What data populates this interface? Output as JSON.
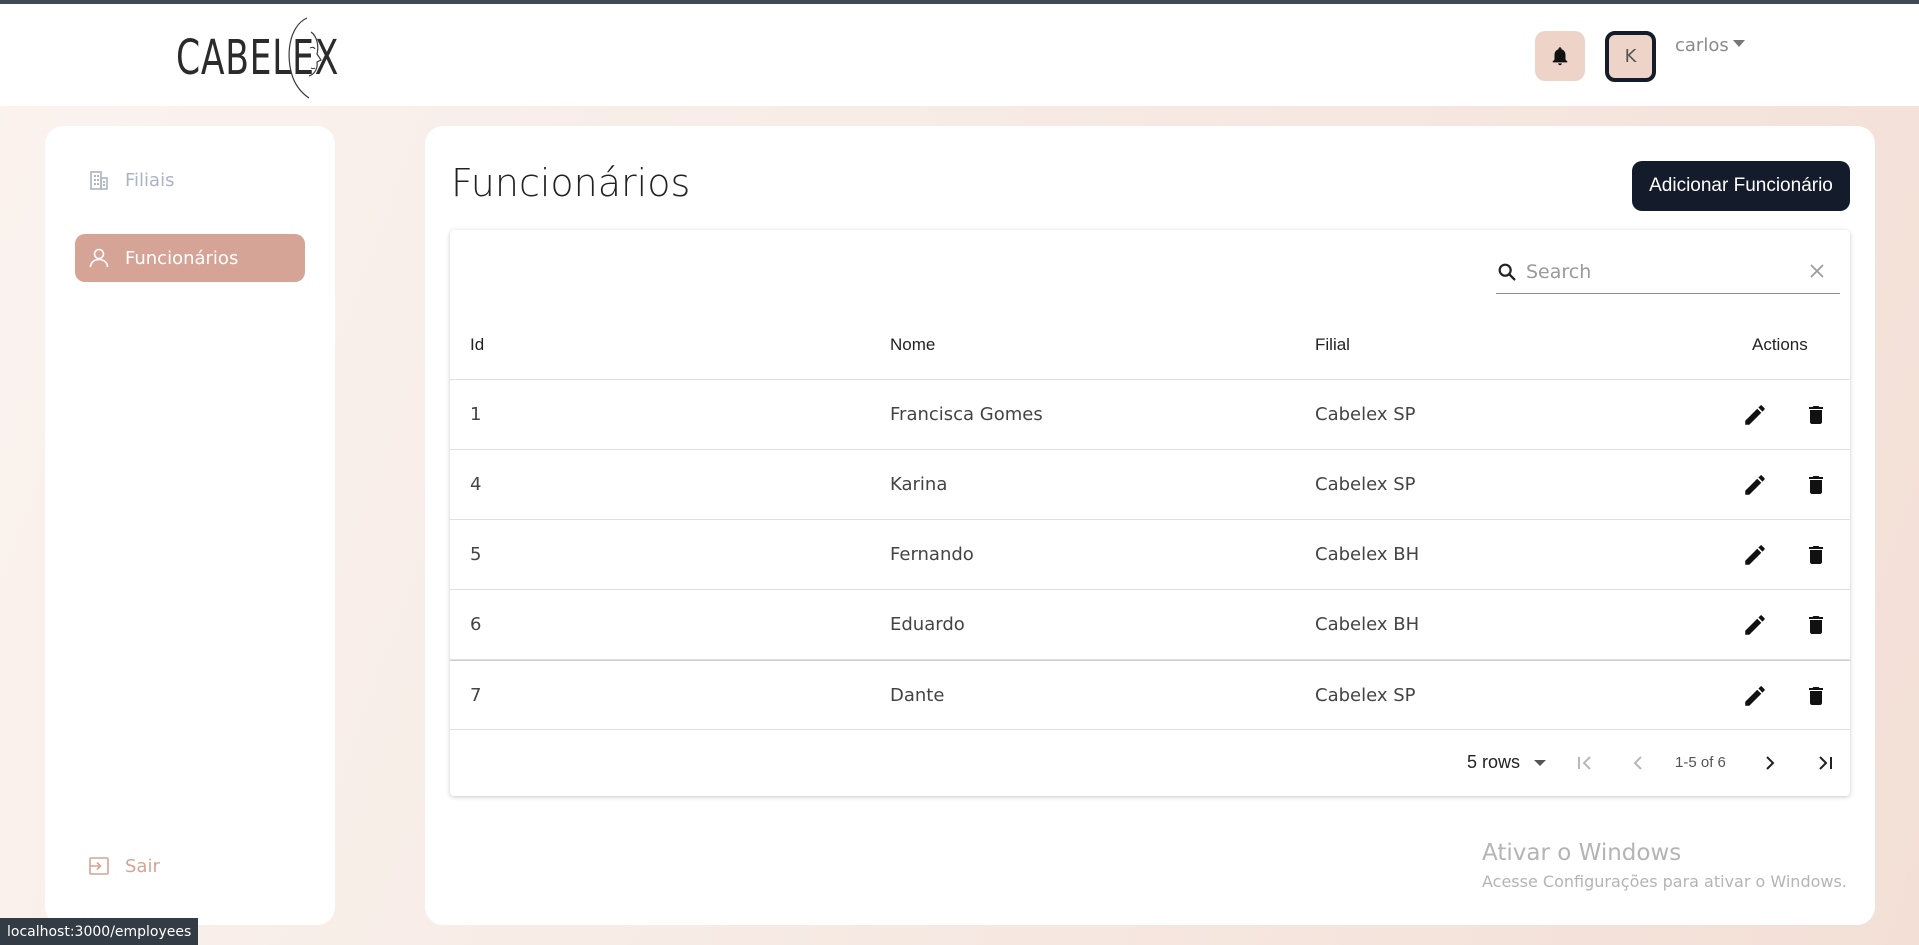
{
  "header": {
    "logo_text": "CABELEX",
    "avatar_initial": "K",
    "username": "carlos"
  },
  "sidebar": {
    "items": [
      {
        "label": "Filiais",
        "icon": "building-icon"
      },
      {
        "label": "Funcionários",
        "icon": "user-icon"
      }
    ],
    "logout_label": "Sair"
  },
  "main": {
    "title": "Funcionários",
    "add_button_label": "Adicionar Funcionário",
    "search": {
      "placeholder": "Search"
    },
    "columns": [
      "Id",
      "Nome",
      "Filial",
      "Actions"
    ],
    "rows": [
      {
        "id": "1",
        "nome": "Francisca Gomes",
        "filial": "Cabelex SP"
      },
      {
        "id": "4",
        "nome": "Karina",
        "filial": "Cabelex SP"
      },
      {
        "id": "5",
        "nome": "Fernando",
        "filial": "Cabelex BH"
      },
      {
        "id": "6",
        "nome": "Eduardo",
        "filial": "Cabelex BH"
      },
      {
        "id": "7",
        "nome": "Dante",
        "filial": "Cabelex SP"
      }
    ],
    "pagination": {
      "rows_per_page": "5 rows",
      "info": "1-5 of 6"
    }
  },
  "watermark": {
    "title": "Ativar o Windows",
    "subtitle": "Acesse Configurações para ativar o Windows."
  },
  "status_bar": {
    "url": "localhost:3000/employees"
  },
  "colors": {
    "accent": "#d6a496",
    "dark": "#141c2b",
    "bell_bg": "#eed4c8",
    "inactive_nav": "#aab4c4"
  }
}
